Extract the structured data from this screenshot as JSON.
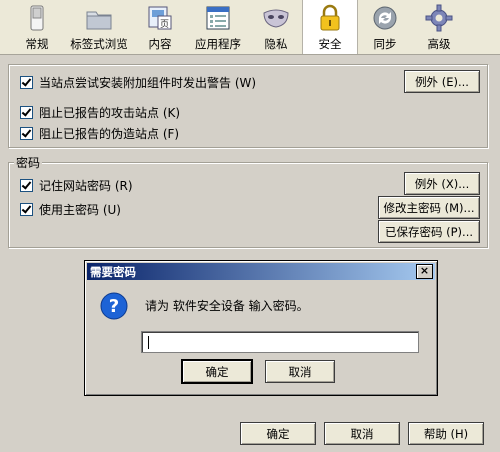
{
  "toolbar": {
    "tabs": [
      {
        "label": "常规",
        "icon": "switch-icon"
      },
      {
        "label": "标签式浏览",
        "icon": "folder-icon"
      },
      {
        "label": "内容",
        "icon": "content-icon"
      },
      {
        "label": "应用程序",
        "icon": "application-window-icon"
      },
      {
        "label": "隐私",
        "icon": "mask-icon"
      },
      {
        "label": "安全",
        "icon": "padlock-icon"
      },
      {
        "label": "同步",
        "icon": "sync-icon"
      },
      {
        "label": "高级",
        "icon": "gear-icon"
      }
    ],
    "active": "安全"
  },
  "security": {
    "warn_addons": "当站点尝试安装附加组件时发出警告 (W)",
    "block_attack": "阻止已报告的攻击站点 (K)",
    "block_forgery": "阻止已报告的伪造站点 (F)",
    "exceptions_btn": "例外 (E)..."
  },
  "passwords": {
    "section_title": "密码",
    "remember": "记住网站密码 (R)",
    "use_master": "使用主密码 (U)",
    "exceptions_btn": "例外 (X)...",
    "change_master_btn": "修改主密码 (M)...",
    "saved_btn": "已保存密码 (P)..."
  },
  "dialog": {
    "title": "需要密码",
    "close": "×",
    "message": "请为 软件安全设备 输入密码。",
    "input_value": "",
    "ok": "确定",
    "cancel": "取消",
    "icon": "question-icon"
  },
  "footer": {
    "ok": "确定",
    "cancel": "取消",
    "help": "帮助 (H)"
  },
  "colors": {
    "titlebar_start": "#0a246a",
    "titlebar_end": "#a6caf0",
    "face": "#d4d0c8",
    "active_tab": "#ffffff"
  }
}
